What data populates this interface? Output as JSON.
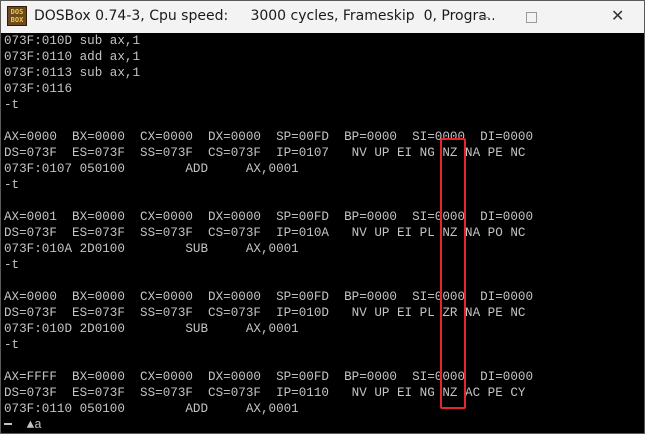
{
  "window": {
    "title": "DOSBox 0.74-3, Cpu speed:     3000 cycles, Frameskip  0, Progra...",
    "icon_text": "DOS\nBOX",
    "controls": {
      "minimize": "minimize",
      "maximize": "maximize",
      "close": "✕"
    }
  },
  "console": {
    "lines": [
      "073F:010D sub ax,1",
      "073F:0110 add ax,1",
      "073F:0113 sub ax,1",
      "073F:0116",
      "-t",
      "",
      "AX=0000  BX=0000  CX=0000  DX=0000  SP=00FD  BP=0000  SI=0000  DI=0000",
      "DS=073F  ES=073F  SS=073F  CS=073F  IP=0107   NV UP EI NG NZ NA PE NC",
      "073F:0107 050100        ADD     AX,0001",
      "-t",
      "",
      "AX=0001  BX=0000  CX=0000  DX=0000  SP=00FD  BP=0000  SI=0000  DI=0000",
      "DS=073F  ES=073F  SS=073F  CS=073F  IP=010A   NV UP EI PL NZ NA PO NC",
      "073F:010A 2D0100        SUB     AX,0001",
      "-t",
      "",
      "AX=0000  BX=0000  CX=0000  DX=0000  SP=00FD  BP=0000  SI=0000  DI=0000",
      "DS=073F  ES=073F  SS=073F  CS=073F  IP=010D   NV UP EI PL ZR NA PE NC",
      "073F:010D 2D0100        SUB     AX,0001",
      "-t",
      "",
      "AX=FFFF  BX=0000  CX=0000  DX=0000  SP=00FD  BP=0000  SI=0000  DI=0000",
      "DS=073F  ES=073F  SS=073F  CS=073F  IP=0110   NV UP EI NG NZ AC PE CY",
      "073F:0110 050100        ADD     AX,0001",
      "-  ▲a"
    ]
  },
  "colors": {
    "console_bg": "#000000",
    "console_text": "#c4c4c4",
    "highlight": "#e5252b",
    "titlebar_bg": "#f3f3f3"
  }
}
